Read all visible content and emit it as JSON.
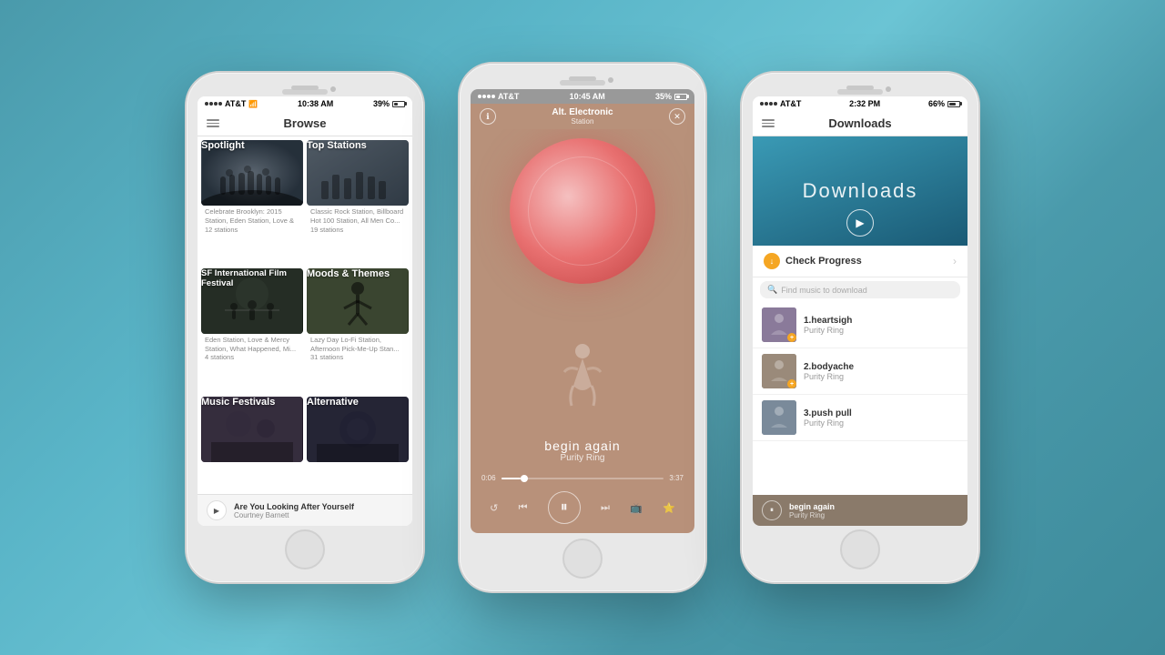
{
  "background": {
    "color": "#5aafbf"
  },
  "phone1": {
    "status": {
      "carrier": "AT&T",
      "time": "10:38 AM",
      "battery": "39%"
    },
    "header": {
      "title": "Browse"
    },
    "cards": [
      {
        "id": "spotlight",
        "label": "Spotlight",
        "desc": "Celebrate Brooklyn: 2015 Station, Eden Station, Love & 12 stations"
      },
      {
        "id": "top-stations",
        "label": "Top Stations",
        "desc": "Classic Rock Station, Billboard Hot 100 Station, All Men Co... 19 stations"
      },
      {
        "id": "sf-film",
        "label": "SF International Film Festival",
        "desc": "Eden Station, Love & Mercy Station, What Happened, Mi... 4 stations"
      },
      {
        "id": "moods-themes",
        "label": "Moods & Themes",
        "desc": "Lazy Day Lo-Fi Station, Afternoon Pick-Me-Up Stan... 31 stations"
      },
      {
        "id": "music-festivals",
        "label": "Music Festivals",
        "desc": ""
      },
      {
        "id": "alternative",
        "label": "Alternative",
        "desc": ""
      }
    ],
    "nowPlaying": {
      "title": "Are You Looking After Yourself",
      "artist": "Courtney Barnett"
    }
  },
  "phone2": {
    "status": {
      "carrier": "AT&T",
      "time": "10:45 AM",
      "battery": "35%"
    },
    "player": {
      "stationName": "Alt. Electronic",
      "stationSub": "Station",
      "trackName": "begin again",
      "trackArtist": "Purity Ring",
      "timeElapsed": "0:06",
      "timeTotal": "3:37",
      "progressPercent": 12
    }
  },
  "phone3": {
    "status": {
      "carrier": "AT&T",
      "time": "2:32 PM",
      "battery": "66%"
    },
    "header": {
      "title": "Downloads"
    },
    "hero": {
      "title": "Downloads"
    },
    "checkProgress": {
      "label": "Check Progress"
    },
    "search": {
      "placeholder": "Find music to download"
    },
    "tracks": [
      {
        "num": "1.",
        "name": "heartsigh",
        "artist": "Purity Ring"
      },
      {
        "num": "2.",
        "name": "bodyache",
        "artist": "Purity Ring"
      },
      {
        "num": "3.",
        "name": "push pull",
        "artist": "Purity Ring"
      }
    ],
    "nowPlaying": {
      "title": "begin again",
      "artist": "Purity Ring"
    }
  }
}
